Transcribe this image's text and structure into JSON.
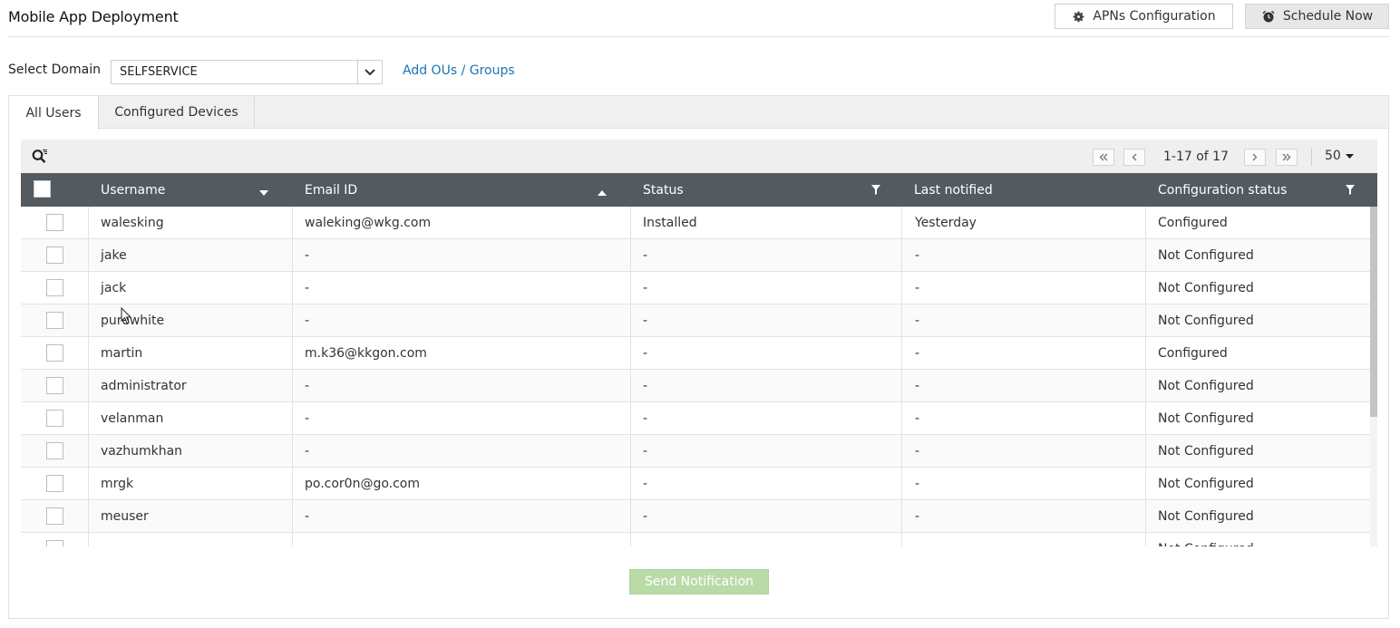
{
  "header": {
    "title": "Mobile App Deployment",
    "apns_label": "APNs Configuration",
    "schedule_label": "Schedule Now"
  },
  "domain": {
    "label": "Select Domain",
    "selected": "SELFSERVICE",
    "add_ous_label": "Add OUs / Groups"
  },
  "tabs": [
    {
      "label": "All Users",
      "active": true
    },
    {
      "label": "Configured Devices",
      "active": false
    }
  ],
  "pagination": {
    "info": "1-17 of 17",
    "page_size": "50"
  },
  "table": {
    "columns": [
      "Username",
      "Email ID",
      "Status",
      "Last notified",
      "Configuration status"
    ],
    "rows": [
      {
        "username": "walesking",
        "email": "waleking@wkg.com",
        "status": "Installed",
        "last_notified": "Yesterday",
        "config_status": "Configured"
      },
      {
        "username": "jake",
        "email": "-",
        "status": "-",
        "last_notified": "-",
        "config_status": "Not Configured"
      },
      {
        "username": "jack",
        "email": "-",
        "status": "-",
        "last_notified": "-",
        "config_status": "Not Configured"
      },
      {
        "username": "purewhite",
        "email": "-",
        "status": "-",
        "last_notified": "-",
        "config_status": "Not Configured"
      },
      {
        "username": "martin",
        "email": "m.k36@kkgon.com",
        "status": "-",
        "last_notified": "-",
        "config_status": "Configured"
      },
      {
        "username": "administrator",
        "email": "-",
        "status": "-",
        "last_notified": "-",
        "config_status": "Not Configured"
      },
      {
        "username": "velanman",
        "email": "-",
        "status": "-",
        "last_notified": "-",
        "config_status": "Not Configured"
      },
      {
        "username": "vazhumkhan",
        "email": "-",
        "status": "-",
        "last_notified": "-",
        "config_status": "Not Configured"
      },
      {
        "username": "mrgk",
        "email": "po.cor0n@go.com",
        "status": "-",
        "last_notified": "-",
        "config_status": "Not Configured"
      },
      {
        "username": "meuser",
        "email": "-",
        "status": "-",
        "last_notified": "-",
        "config_status": "Not Configured"
      },
      {
        "username": "",
        "email": "-",
        "status": "-",
        "last_notified": "-",
        "config_status": "Not Configured"
      }
    ]
  },
  "footer": {
    "send_label": "Send Notification"
  },
  "colors": {
    "header_bg": "#535b61",
    "link": "#1a73b5",
    "send_disabled": "#b9dba8"
  }
}
